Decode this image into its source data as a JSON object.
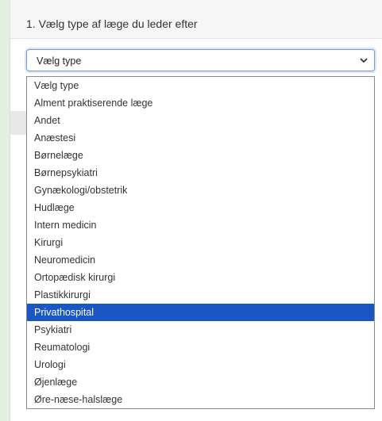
{
  "question": {
    "title": "1. Vælg type af læge du leder efter"
  },
  "select": {
    "current_value": "Vælg type"
  },
  "dropdown": {
    "options": [
      "Vælg type",
      "Alment praktiserende læge",
      "Andet",
      "Anæstesi",
      "Børnelæge",
      "Børnepsykiatri",
      "Gynækologi/obstetrik",
      "Hudlæge",
      "Intern medicin",
      "Kirurgi",
      "Neuromedicin",
      "Ortopædisk kirurgi",
      "Plastikkirurgi",
      "Privathospital",
      "Psykiatri",
      "Reumatologi",
      "Urologi",
      "Øjenlæge",
      "Øre-næse-halslæge"
    ],
    "highlighted_option": "Privathospital",
    "highlight_color": "#1a56c4"
  },
  "icons": {
    "select_arrow": "chevron-down-icon"
  }
}
